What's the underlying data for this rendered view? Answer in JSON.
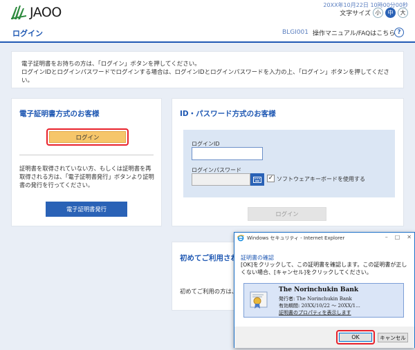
{
  "header": {
    "logo_text": "JAOO",
    "datetime": "20XX年10月22日 10時00分00秒",
    "font_size_label": "文字サイズ",
    "font_sizes": [
      "小",
      "中",
      "大"
    ],
    "font_size_selected": "中"
  },
  "titlebar": {
    "title": "ログイン",
    "screen_id": "BLGI001",
    "manual_link": "操作マニュアル/FAQはこちら",
    "help": "?"
  },
  "info": {
    "line1": "電子証明書をお持ちの方は、「ログイン」ボタンを押してください。",
    "line2": "ログインIDとログインパスワードでログインする場合は、ログインIDとログインパスワードを入力の上、「ログイン」ボタンを押してください。"
  },
  "cert_card": {
    "title": "電子証明書方式のお客様",
    "login_label": "ログイン",
    "description": "証明書を取得されていない方、もしくは証明書を再取得される方は、「電子証明書発行」ボタンより証明書の発行を行ってください。",
    "issue_label": "電子証明書発行"
  },
  "id_card": {
    "title": "ID・パスワード方式のお客様",
    "login_id_label": "ログインID",
    "password_label": "ログインパスワード",
    "software_kb_label": "ソフトウェアキーボードを使用する",
    "software_kb_checked": "✓",
    "login_label": "ログイン"
  },
  "first_card": {
    "title": "初めてご利用され",
    "description": "初めてご利用の方は、"
  },
  "dialog": {
    "title": "Windows セキュリティ - Internet Explorer",
    "heading": "証明書の確認",
    "text": "[OK]をクリックして、この証明書を確認します。この証明書が正しくない場合、[キャンセル]をクリックしてください。",
    "cert_name": "The Norinchukin Bank",
    "cert_issuer": "発行者:  The Norinchukin Bank",
    "cert_valid": "有効期間:  20XX/10/22 ～ 20XX/1...",
    "cert_properties": "証明書のプロパティを表示します",
    "ok_label": "OK",
    "cancel_label": "キャンセル"
  },
  "colors": {
    "accent": "#1f58b3",
    "highlight": "#e8202a",
    "cert_button": "#f6c66a"
  }
}
